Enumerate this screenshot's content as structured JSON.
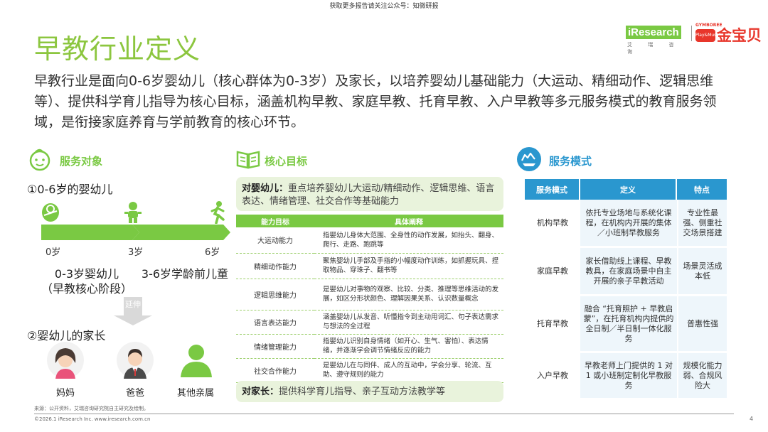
{
  "top_note": "获取更多报告请关注公众号：知微研报",
  "title": "早教行业定义",
  "logos": {
    "iresearch": "iResearch",
    "iresearch_sub": "艾 瑞 咨 询",
    "jinbaobei_small": "GYMBOREE",
    "jinbaobei_badge": "Play&Music",
    "jinbaobei": "金宝贝"
  },
  "intro": "早教行业是面向0-6岁婴幼儿（核心群体为0-3岁）及家长，以培养婴幼儿基础能力（大运动、精细动作、逻辑思维等）、提供科学育儿指导为核心目标，涵盖机构早教、家庭早教、托育早教、入户早教等多元服务模式的教育服务领域，是衔接家庭养育与学前教育的核心环节。",
  "service_target": {
    "heading": "服务对象",
    "target1": "①0-6岁的婴幼儿",
    "ages": [
      "0岁",
      "3岁",
      "6岁"
    ],
    "stage1": "0-3岁婴幼儿",
    "stage1_sub": "（早教核心阶段）",
    "stage2": "3-6岁学龄前儿童",
    "extend": "延伸",
    "target2": "②婴幼儿的家长",
    "people": [
      "妈妈",
      "爸爸",
      "其他亲属"
    ]
  },
  "core_goal": {
    "heading": "核心目标",
    "infant_lead": "对婴幼儿：",
    "infant_text": "重点培养婴幼儿大运动/精细动作、逻辑思维、语言表达、情绪管理、社交合作等基础能力",
    "columns": [
      "能力目标",
      "具体阐释"
    ],
    "rows": [
      {
        "name": "大运动能力",
        "desc": "指婴幼儿身体大范围、全身性的动作发展，如抬头、翻身、爬行、走路、跑跳等"
      },
      {
        "name": "精细动作能力",
        "desc": "聚焦婴幼儿手部及手指的小幅度动作训练，如抓握玩具、捏取物品、穿珠子、翻书等"
      },
      {
        "name": "逻辑思维能力",
        "desc": "是婴幼儿对事物的观察、比较、分类、推理等思维活动的发展，如区分形状颜色、理解因果关系、认识数量概念"
      },
      {
        "name": "语言表达能力",
        "desc": "涵盖婴幼儿从发音、听懂指令到主动用词汇、句子表达需求与想法的全过程"
      },
      {
        "name": "情绪管理能力",
        "desc": "指婴幼儿识别自身情绪（如开心、生气、害怕）、表达情绪，并逐渐学会调节情绪反应的能力"
      },
      {
        "name": "社交合作能力",
        "desc": "是婴幼儿在与同伴、成人的互动中，学会分享、轮流、互助、遵守规则的能力"
      }
    ],
    "parent_lead": "对家长：",
    "parent_text": "提供科学育儿指导、亲子互动方法教学等"
  },
  "service_mode": {
    "heading": "服务模式",
    "columns": [
      "服务模式",
      "定义",
      "特点"
    ],
    "rows": [
      {
        "mode": "机构早教",
        "def": "依托专业场地与系统化课程，在机构内开展的集体／小班制早教服务",
        "feat": "专业性最强、侧重社交场景搭建"
      },
      {
        "mode": "家庭早教",
        "def": "家长借助线上课程、早教教具，在家庭场景中自主开展的亲子早教活动",
        "feat": "场景灵活成本低"
      },
      {
        "mode": "托育早教",
        "def": "融合 “托育照护 + 早教启蒙”，在托育机构内提供的全日制／半日制一体化服务",
        "feat": "普惠性强"
      },
      {
        "mode": "入户早教",
        "def": "早教老师上门提供的 1 对 1 或小班制定制化早教服务",
        "feat": "规模化能力弱、合规风险大"
      }
    ]
  },
  "source": "来源：公开资料，艾瑞咨询研究院自主研究及绘制。",
  "copyright": "©2026.1 iResearch Inc.                                   www.iresearch.com.cn",
  "page_number": "4",
  "colors": {
    "green": "#7ac943",
    "title_green": "#8cc63f",
    "blue": "#2a97cf",
    "light_green": "#e9f3dc"
  }
}
